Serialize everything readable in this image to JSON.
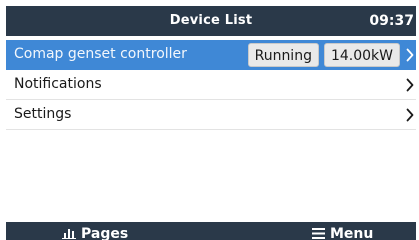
{
  "header": {
    "title": "Device List",
    "time": "09:37"
  },
  "list": {
    "items": [
      {
        "label": "Comap genset controller",
        "status": "Running",
        "power": "14.00kW",
        "selected": true
      },
      {
        "label": "Notifications",
        "selected": false
      },
      {
        "label": "Settings",
        "selected": false
      }
    ]
  },
  "footer": {
    "pages_label": "Pages",
    "pages_icon": "bar-chart-icon",
    "menu_label": "Menu",
    "menu_icon": "hamburger-menu-icon"
  },
  "colors": {
    "bar_background": "#2a3949",
    "selection": "#3f88d6",
    "badge_background": "#e9e9e9",
    "text": "#1a1a1a",
    "bar_text": "#ffffff"
  }
}
